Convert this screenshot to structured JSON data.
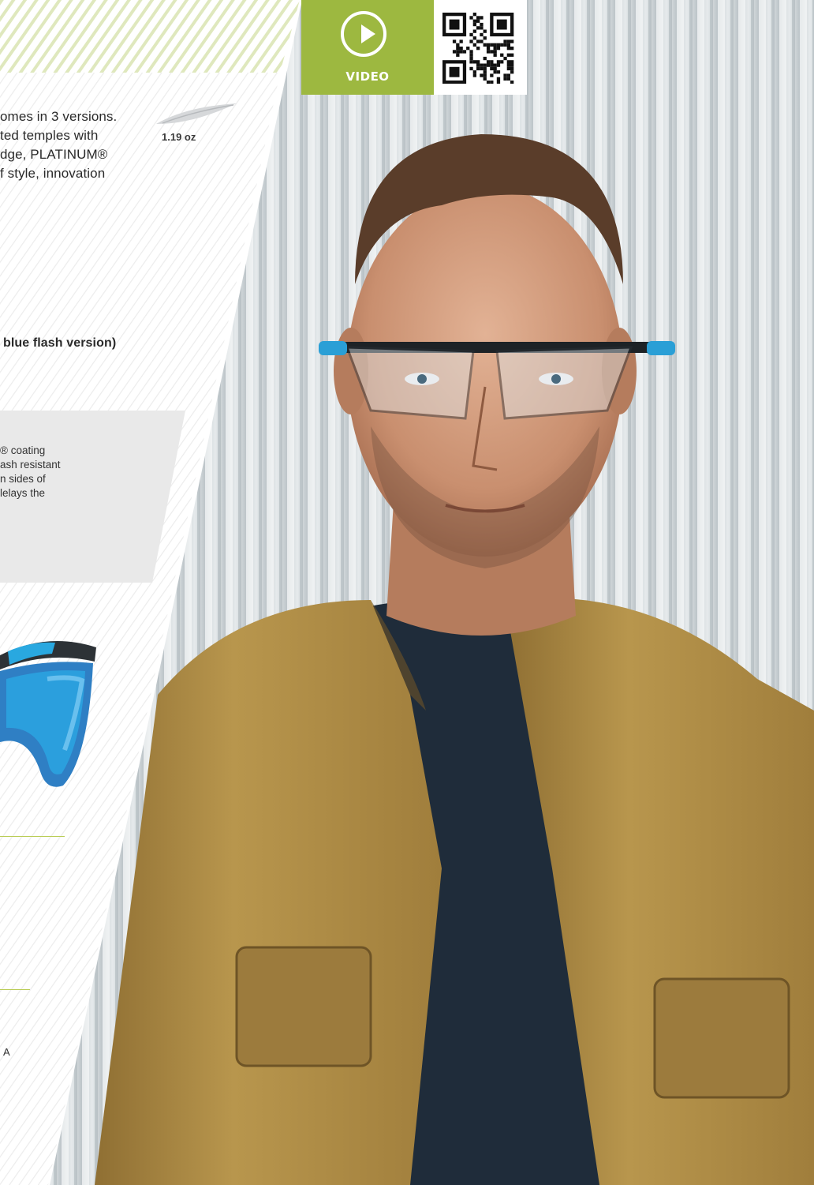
{
  "intro": {
    "lines": [
      "omes in 3 versions.",
      "ted temples with",
      "dge, PLATINUM®",
      "f style, innovation"
    ]
  },
  "weight": "1.19 oz",
  "version_note": "blue flash version)",
  "coating_box": {
    "lines": [
      "® coating",
      "ash resistant",
      "n sides of",
      "lelays the"
    ]
  },
  "video": {
    "label": "VIDEO",
    "icon": "play-icon"
  },
  "qr": {
    "icon": "qr-code-icon"
  },
  "partial_letter": "A",
  "colors": {
    "accent_green": "#9db840",
    "stripe_green": "#dfe8bd",
    "grey_box": "#e9e9e9",
    "lens_blue": "#2a9fd6",
    "vest": "#b08d45",
    "shirt": "#1f2c3a"
  }
}
